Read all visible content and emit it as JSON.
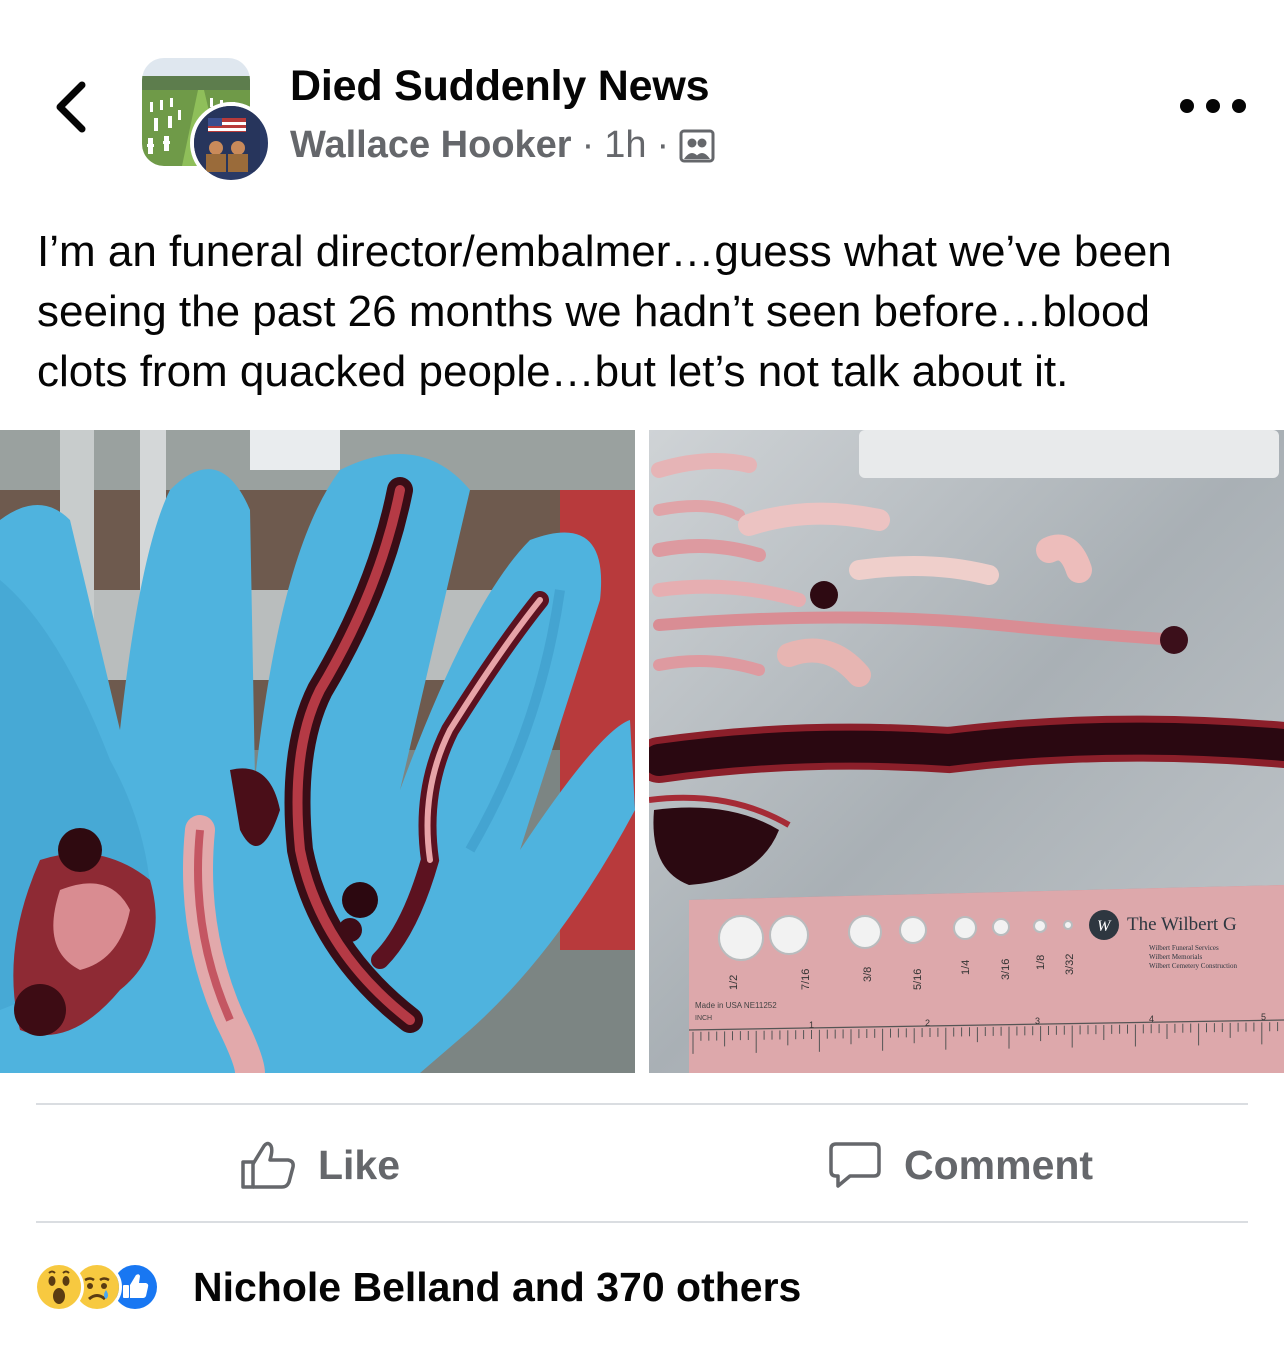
{
  "header": {
    "back_icon": "chevron-left-icon",
    "group_name": "Died Suddenly News",
    "author": "Wallace Hooker",
    "separator": "·",
    "time": "1h",
    "audience_icon": "group-privacy-icon",
    "more_icon": "more-options-icon"
  },
  "post": {
    "text": "I’m an funeral director/embalmer…guess what we’ve been seeing the past 26 months we hadn’t seen before…blood clots from quacked people…but let’s not talk about it."
  },
  "photos": {
    "right": {
      "ruler_holes": [
        "1/2",
        "7/16",
        "3/8",
        "5/16",
        "1/4",
        "3/16",
        "1/8",
        "3/32"
      ],
      "ruler_brand": "The Wilbert G",
      "ruler_subtext": [
        "Wilbert Funeral Services",
        "Wilbert Memorials",
        "Wilbert Cemetery Construction"
      ],
      "ruler_inch_marks": [
        "1",
        "2",
        "3",
        "4",
        "5"
      ],
      "ruler_made": "Made in USA  NE11252",
      "ruler_unit": "INCH"
    }
  },
  "actions": {
    "like_label": "Like",
    "comment_label": "Comment"
  },
  "reactions": {
    "icons": [
      "wow-reaction-icon",
      "sad-reaction-icon",
      "like-reaction-icon"
    ],
    "summary": "Nichole Belland and 370 others"
  },
  "colors": {
    "text_primary": "#050505",
    "text_secondary": "#65676b",
    "like_blue": "#1877f2",
    "divider": "#dadde1"
  }
}
